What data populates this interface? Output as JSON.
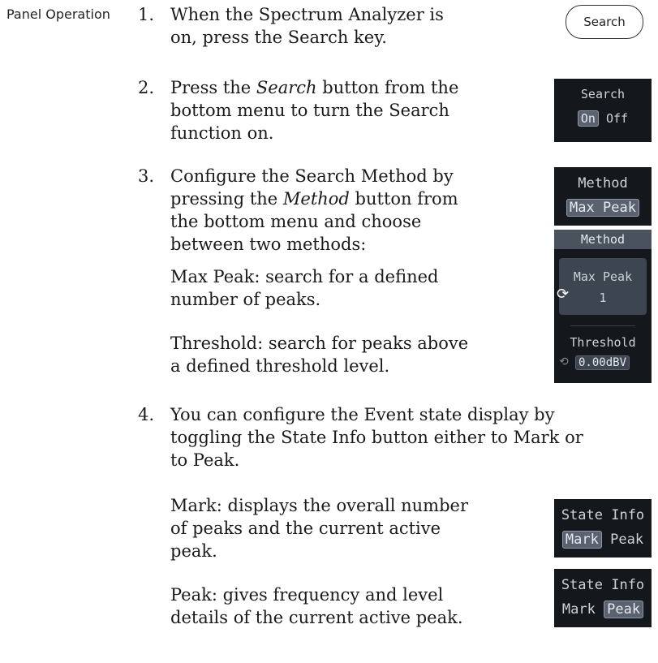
{
  "side_label": "Panel Operation",
  "steps": [
    {
      "num": "1.",
      "lines": [
        "When the Spectrum Analyzer is",
        "on, press the Search key."
      ]
    },
    {
      "num": "2.",
      "line1_pre": "Press the ",
      "line1_em": "Search",
      "line1_post": " button from the",
      "lines_rest": [
        "bottom menu to turn the Search",
        "function on."
      ]
    },
    {
      "num": "3.",
      "l1": "Configure the Search Method by",
      "l2_pre": "pressing the ",
      "l2_em": "Method",
      "l2_post": " button from",
      "lines_rest": [
        "the bottom menu and choose",
        "between two methods:"
      ]
    },
    {
      "num": "4.",
      "lines": [
        "You can configure the Event state display by",
        "toggling the State Info button either to Mark or",
        "to Peak."
      ]
    }
  ],
  "max_peak_desc": [
    "Max Peak: search for a defined",
    "number of peaks."
  ],
  "threshold_desc": [
    "Threshold: search for peaks above",
    "a defined threshold level."
  ],
  "mark_desc": [
    "Mark: displays the overall number",
    "of peaks and the current active",
    "peak."
  ],
  "peak_desc": [
    "Peak: gives frequency and level",
    "details of the current active peak."
  ],
  "ui": {
    "search_key": "Search",
    "search_menu": {
      "title": "Search",
      "on": "On",
      "off": "Off"
    },
    "method_menu": {
      "title": "Method",
      "value": "Max Peak"
    },
    "method_panel": {
      "title": "Method",
      "maxpeak_label": "Max Peak",
      "maxpeak_value": "1",
      "threshold_label": "Threshold",
      "threshold_value": "0.00dBV"
    },
    "state_info_mark": {
      "title": "State Info",
      "mark": "Mark",
      "peak": "Peak"
    },
    "state_info_peak": {
      "title": "State Info",
      "mark": "Mark",
      "peak": "Peak"
    }
  }
}
